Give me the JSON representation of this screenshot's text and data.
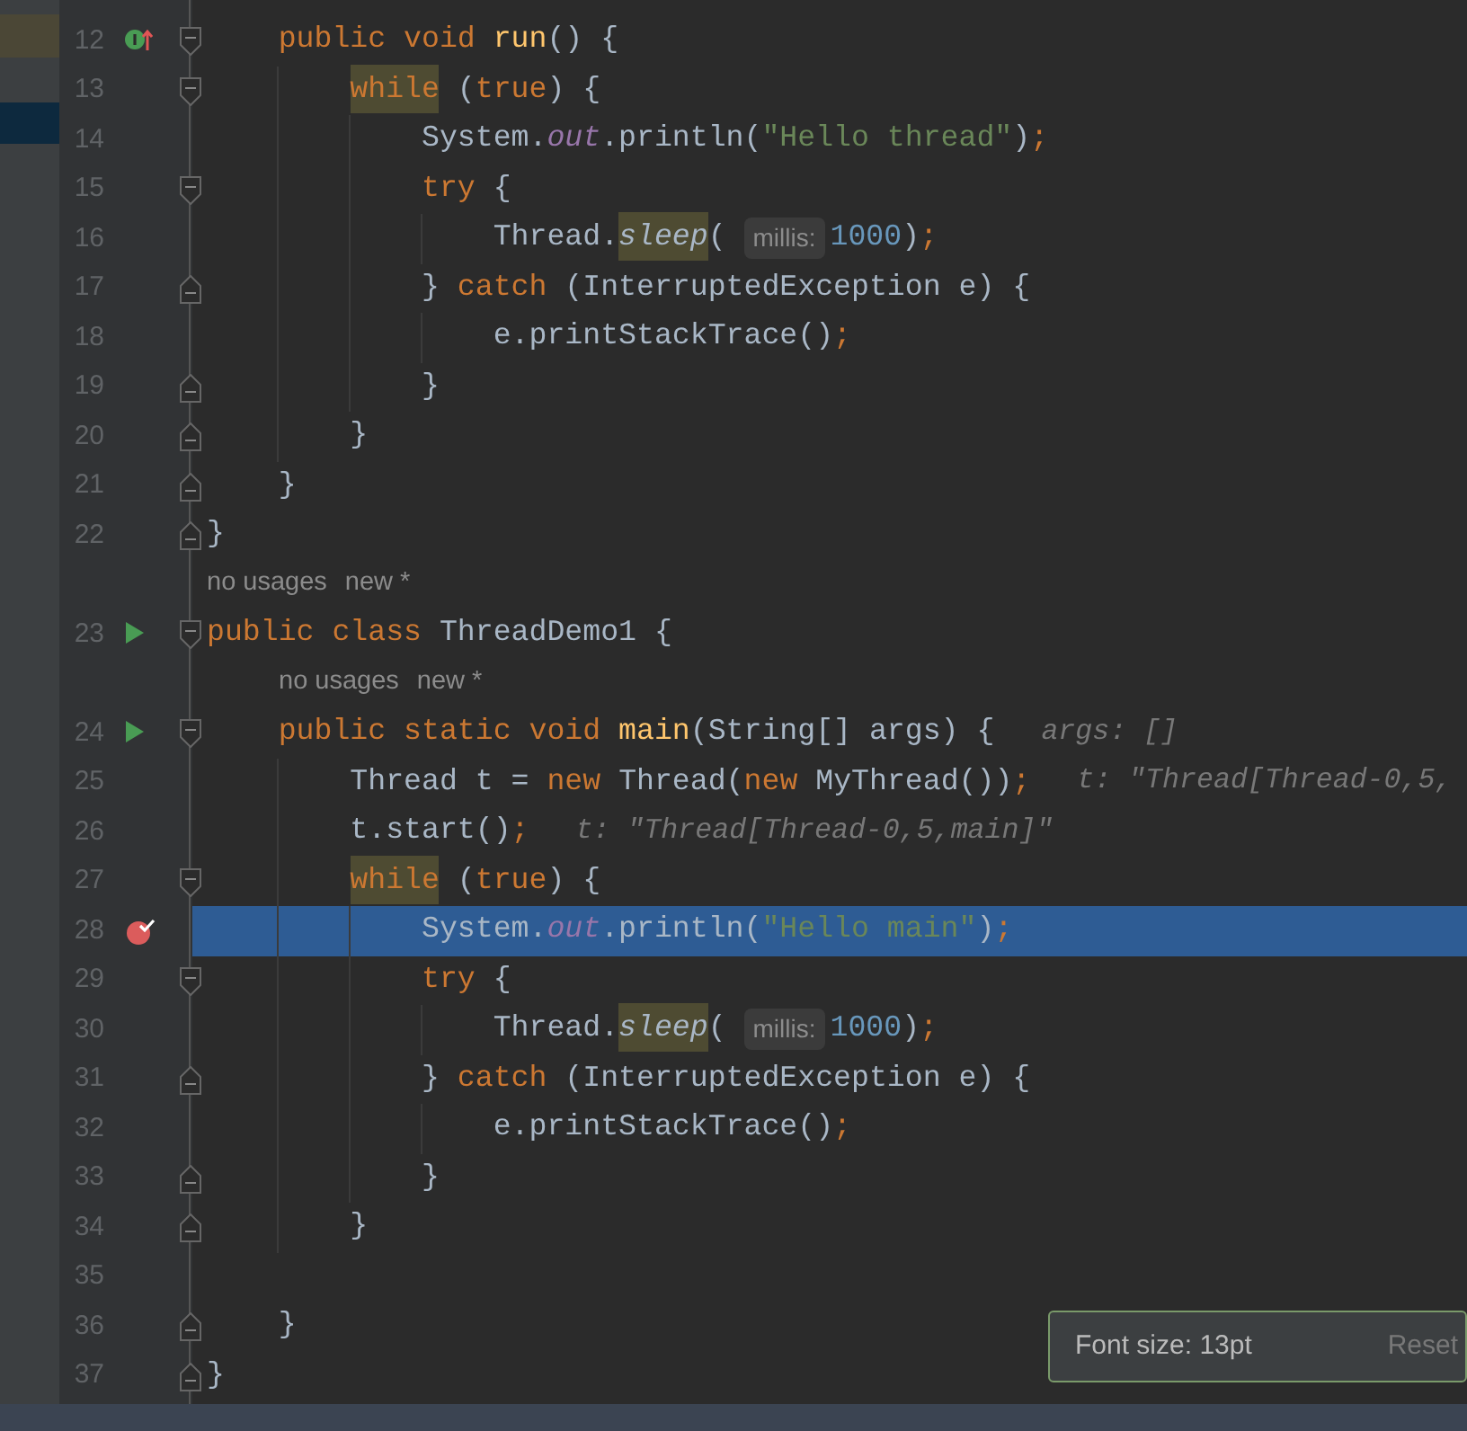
{
  "editor": {
    "lines": [
      {
        "kind": "code",
        "number": "12",
        "fold_marker": {
          "kind": "start"
        },
        "gutter_icon": {
          "kind": "override"
        },
        "current": false,
        "tokens": [
          {
            "kind": "kw",
            "s": "    public void "
          },
          {
            "kind": "decl",
            "s": "run"
          },
          {
            "kind": "plain",
            "s": "() {"
          }
        ]
      },
      {
        "kind": "code",
        "number": "13",
        "fold_marker": {
          "kind": "start"
        },
        "current": false,
        "tokens": [
          {
            "kind": "kw",
            "s": "        while",
            "highlight": true
          },
          {
            "kind": "plain",
            "s": " ("
          },
          {
            "kind": "kw",
            "s": "true"
          },
          {
            "kind": "plain",
            "s": ") {"
          }
        ]
      },
      {
        "kind": "code",
        "number": "14",
        "current": false,
        "tokens": [
          {
            "kind": "plain",
            "s": "            System."
          },
          {
            "kind": "field",
            "s": "out"
          },
          {
            "kind": "plain",
            "s": ".println("
          },
          {
            "kind": "str",
            "s": "\"Hello thread\""
          },
          {
            "kind": "plain",
            "s": ")"
          },
          {
            "kind": "kw",
            "s": ";"
          }
        ]
      },
      {
        "kind": "code",
        "number": "15",
        "fold_marker": {
          "kind": "start"
        },
        "current": false,
        "tokens": [
          {
            "kind": "kw",
            "s": "            try"
          },
          {
            "kind": "plain",
            "s": " {"
          }
        ]
      },
      {
        "kind": "code",
        "number": "16",
        "current": false,
        "tokens": [
          {
            "kind": "plain",
            "s": "                Thread."
          },
          {
            "kind": "static",
            "s": "sleep",
            "highlight": true
          },
          {
            "kind": "plain",
            "s": "( "
          },
          {
            "kind": "inlay",
            "s": "millis:"
          },
          {
            "kind": "num",
            "s": "1000"
          },
          {
            "kind": "plain",
            "s": ")"
          },
          {
            "kind": "kw",
            "s": ";"
          }
        ]
      },
      {
        "kind": "code",
        "number": "17",
        "fold_marker": {
          "kind": "end"
        },
        "current": false,
        "tokens": [
          {
            "kind": "plain",
            "s": "            } "
          },
          {
            "kind": "kw",
            "s": "catch"
          },
          {
            "kind": "plain",
            "s": " (InterruptedException e) {"
          }
        ]
      },
      {
        "kind": "code",
        "number": "18",
        "current": false,
        "tokens": [
          {
            "kind": "plain",
            "s": "                e.printStackTrace()"
          },
          {
            "kind": "kw",
            "s": ";"
          }
        ]
      },
      {
        "kind": "code",
        "number": "19",
        "fold_marker": {
          "kind": "end"
        },
        "current": false,
        "tokens": [
          {
            "kind": "plain",
            "s": "            }"
          }
        ]
      },
      {
        "kind": "code",
        "number": "20",
        "fold_marker": {
          "kind": "end"
        },
        "current": false,
        "tokens": [
          {
            "kind": "plain",
            "s": "        }"
          }
        ]
      },
      {
        "kind": "code",
        "number": "21",
        "fold_marker": {
          "kind": "end"
        },
        "current": false,
        "tokens": [
          {
            "kind": "plain",
            "s": "    }"
          }
        ]
      },
      {
        "kind": "code",
        "number": "22",
        "fold_marker": {
          "kind": "end"
        },
        "current": false,
        "tokens": [
          {
            "kind": "plain",
            "s": "}"
          }
        ]
      },
      {
        "kind": "hint",
        "texts": [
          "no usages",
          "new *"
        ]
      },
      {
        "kind": "code",
        "number": "23",
        "fold_marker": {
          "kind": "start"
        },
        "gutter_icon": {
          "kind": "run"
        },
        "current": false,
        "tokens": [
          {
            "kind": "kw",
            "s": "public class "
          },
          {
            "kind": "plain",
            "s": "ThreadDemo1 {"
          }
        ]
      },
      {
        "kind": "hint",
        "texts": [
          "no usages",
          "new *"
        ]
      },
      {
        "kind": "code",
        "number": "24",
        "fold_marker": {
          "kind": "start"
        },
        "gutter_icon": {
          "kind": "run"
        },
        "current": false,
        "tokens": [
          {
            "kind": "kw",
            "s": "    public static void "
          },
          {
            "kind": "decl",
            "s": "main"
          },
          {
            "kind": "plain",
            "s": "(String[] args) {"
          },
          {
            "kind": "debug",
            "s": "args: []"
          }
        ]
      },
      {
        "kind": "code",
        "number": "25",
        "current": false,
        "tokens": [
          {
            "kind": "plain",
            "s": "        Thread t = "
          },
          {
            "kind": "kw",
            "s": "new "
          },
          {
            "kind": "plain",
            "s": "Thread("
          },
          {
            "kind": "kw",
            "s": "new "
          },
          {
            "kind": "plain",
            "s": "MyThread())"
          },
          {
            "kind": "kw",
            "s": ";"
          },
          {
            "kind": "debug",
            "s": "t: \"Thread[Thread-0,5,"
          }
        ]
      },
      {
        "kind": "code",
        "number": "26",
        "current": false,
        "tokens": [
          {
            "kind": "plain",
            "s": "        t.start()"
          },
          {
            "kind": "kw",
            "s": ";"
          },
          {
            "kind": "debug",
            "s": "t: \"Thread[Thread-0,5,main]\""
          }
        ]
      },
      {
        "kind": "code",
        "number": "27",
        "fold_marker": {
          "kind": "start"
        },
        "current": false,
        "tokens": [
          {
            "kind": "kw",
            "s": "        while",
            "highlight": true
          },
          {
            "kind": "plain",
            "s": " ("
          },
          {
            "kind": "kw",
            "s": "true"
          },
          {
            "kind": "plain",
            "s": ") {"
          }
        ]
      },
      {
        "kind": "code",
        "number": "28",
        "gutter_icon": {
          "kind": "breakpoint"
        },
        "current": true,
        "tokens": [
          {
            "kind": "plain",
            "s": "            System."
          },
          {
            "kind": "field",
            "s": "out"
          },
          {
            "kind": "plain",
            "s": ".println("
          },
          {
            "kind": "str",
            "s": "\"Hello main\""
          },
          {
            "kind": "plain",
            "s": ")"
          },
          {
            "kind": "kw",
            "s": ";"
          }
        ]
      },
      {
        "kind": "code",
        "number": "29",
        "fold_marker": {
          "kind": "start"
        },
        "current": false,
        "tokens": [
          {
            "kind": "kw",
            "s": "            try"
          },
          {
            "kind": "plain",
            "s": " {"
          }
        ]
      },
      {
        "kind": "code",
        "number": "30",
        "current": false,
        "tokens": [
          {
            "kind": "plain",
            "s": "                Thread."
          },
          {
            "kind": "static",
            "s": "sleep",
            "highlight": true
          },
          {
            "kind": "plain",
            "s": "( "
          },
          {
            "kind": "inlay",
            "s": "millis:"
          },
          {
            "kind": "num",
            "s": "1000"
          },
          {
            "kind": "plain",
            "s": ")"
          },
          {
            "kind": "kw",
            "s": ";"
          }
        ]
      },
      {
        "kind": "code",
        "number": "31",
        "fold_marker": {
          "kind": "end"
        },
        "current": false,
        "tokens": [
          {
            "kind": "plain",
            "s": "            } "
          },
          {
            "kind": "kw",
            "s": "catch"
          },
          {
            "kind": "plain",
            "s": " (InterruptedException e) {"
          }
        ]
      },
      {
        "kind": "code",
        "number": "32",
        "current": false,
        "tokens": [
          {
            "kind": "plain",
            "s": "                e.printStackTrace()"
          },
          {
            "kind": "kw",
            "s": ";"
          }
        ]
      },
      {
        "kind": "code",
        "number": "33",
        "fold_marker": {
          "kind": "end"
        },
        "current": false,
        "tokens": [
          {
            "kind": "plain",
            "s": "            }"
          }
        ]
      },
      {
        "kind": "code",
        "number": "34",
        "fold_marker": {
          "kind": "end"
        },
        "current": false,
        "tokens": [
          {
            "kind": "plain",
            "s": "        }"
          }
        ]
      },
      {
        "kind": "code",
        "number": "35",
        "current": false
      },
      {
        "kind": "code",
        "number": "36",
        "fold_marker": {
          "kind": "end"
        },
        "current": false,
        "tokens": [
          {
            "kind": "plain",
            "s": "    }"
          }
        ]
      },
      {
        "kind": "code",
        "number": "37",
        "fold_marker": {
          "kind": "end"
        },
        "current": false,
        "tokens": [
          {
            "kind": "plain",
            "s": "}"
          }
        ]
      }
    ]
  },
  "font_popup": {
    "message": "Font size: 13pt",
    "action": "Reset"
  }
}
